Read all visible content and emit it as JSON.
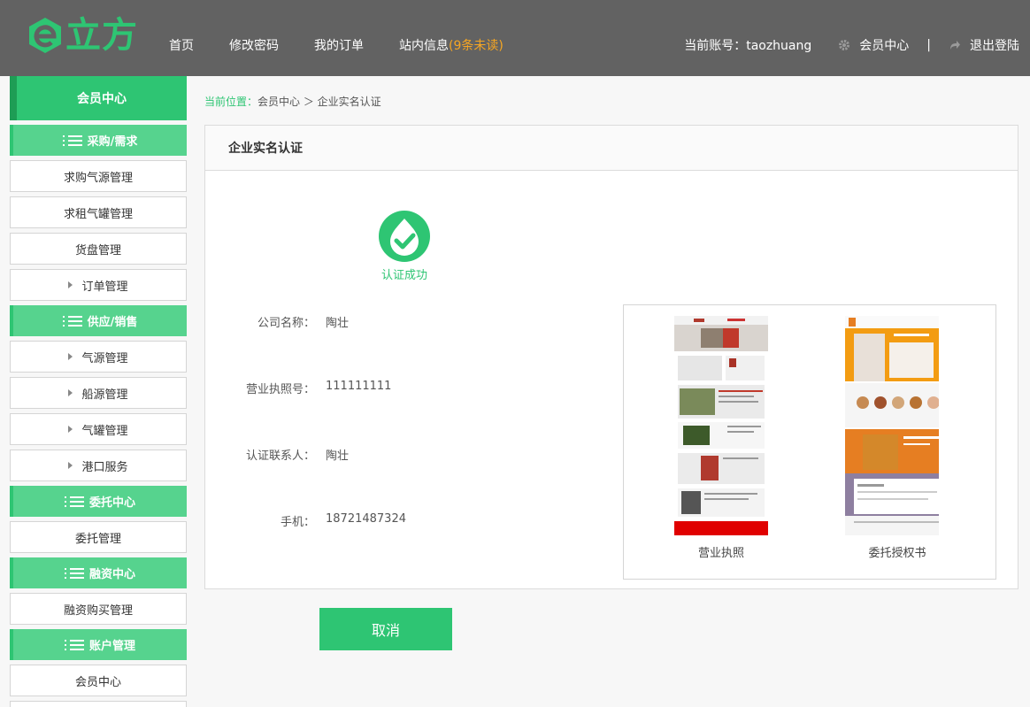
{
  "brand": {
    "logo_text": "立方",
    "accent": "#2ec573"
  },
  "nav": {
    "items": [
      {
        "label": "首页"
      },
      {
        "label": "修改密码"
      },
      {
        "label": "我的订单"
      }
    ],
    "messages_label": "站内信息",
    "messages_unread": "(9条未读)"
  },
  "header_right": {
    "account_label": "当前账号：taozhuang",
    "member_center": "会员中心",
    "separator": "|",
    "logout": "退出登陆"
  },
  "sidebar": {
    "title": "会员中心",
    "groups": [
      {
        "label": "采购/需求",
        "items": [
          {
            "label": "求购气源管理",
            "arrow": false
          },
          {
            "label": "求租气罐管理",
            "arrow": false
          },
          {
            "label": "货盘管理",
            "arrow": false
          },
          {
            "label": "订单管理",
            "arrow": true
          }
        ]
      },
      {
        "label": "供应/销售",
        "items": [
          {
            "label": "气源管理",
            "arrow": true
          },
          {
            "label": "船源管理",
            "arrow": true
          },
          {
            "label": "气罐管理",
            "arrow": true
          },
          {
            "label": "港口服务",
            "arrow": true
          }
        ]
      },
      {
        "label": "委托中心",
        "items": [
          {
            "label": "委托管理",
            "arrow": false
          }
        ]
      },
      {
        "label": "融资中心",
        "items": [
          {
            "label": "融资购买管理",
            "arrow": false
          }
        ]
      },
      {
        "label": "账户管理",
        "items": [
          {
            "label": "会员中心",
            "arrow": false
          }
        ]
      }
    ]
  },
  "breadcrumb": {
    "current_label": "当前位置：",
    "path": "会员中心 ＞ 企业实名认证"
  },
  "panel": {
    "title": "企业实名认证",
    "status": "认证成功",
    "fields": [
      {
        "label": "公司名称：",
        "value": "陶壮"
      },
      {
        "label": "营业执照号：",
        "value": "111111111"
      },
      {
        "label": "认证联系人：",
        "value": "陶壮"
      },
      {
        "label": "手机：",
        "value": "18721487324"
      }
    ],
    "images": [
      {
        "caption": "营业执照"
      },
      {
        "caption": "委托授权书"
      }
    ]
  },
  "cancel_label": "取消"
}
